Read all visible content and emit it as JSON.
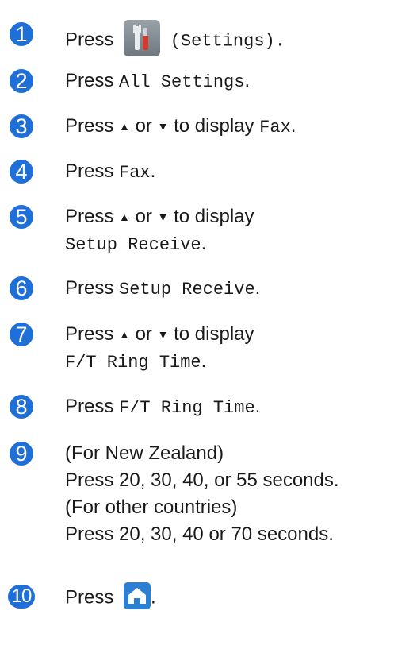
{
  "steps": [
    {
      "num": "1",
      "press": "Press",
      "after": "(Settings)."
    },
    {
      "num": "2",
      "press": "Press",
      "code": "All Settings",
      "end": "."
    },
    {
      "num": "3",
      "text": "Press",
      "up": "▲",
      "or": "or",
      "down": "▼",
      "to": "to display",
      "code": "Fax",
      "end": "."
    },
    {
      "num": "4",
      "press": "Press",
      "code": "Fax",
      "end": "."
    },
    {
      "num": "5",
      "text": "Press",
      "up": "▲",
      "or": "or",
      "down": "▼",
      "to": "to display",
      "code": "Setup Receive",
      "end": "."
    },
    {
      "num": "6",
      "press": "Press",
      "code": "Setup Receive",
      "end": "."
    },
    {
      "num": "7",
      "text": "Press",
      "up": "▲",
      "or": "or",
      "down": "▼",
      "to": "to display",
      "code": "F/T Ring Time",
      "end": "."
    },
    {
      "num": "8",
      "press": "Press",
      "code": "F/T Ring Time",
      "end": "."
    },
    {
      "num": "9",
      "l1": "(For New Zealand)",
      "l2": "Press 20, 30, 40, or 55 seconds.",
      "l3": "(For other countries)",
      "l4": "Press 20, 30, 40 or 70 seconds."
    },
    {
      "num": "10",
      "press": "Press",
      "end": "."
    }
  ],
  "icons": {
    "step1": "settings-icon",
    "step10": "home-icon"
  },
  "colors": {
    "badge": "#1f6fd8",
    "home_icon_bg": "#2d7fd3"
  }
}
